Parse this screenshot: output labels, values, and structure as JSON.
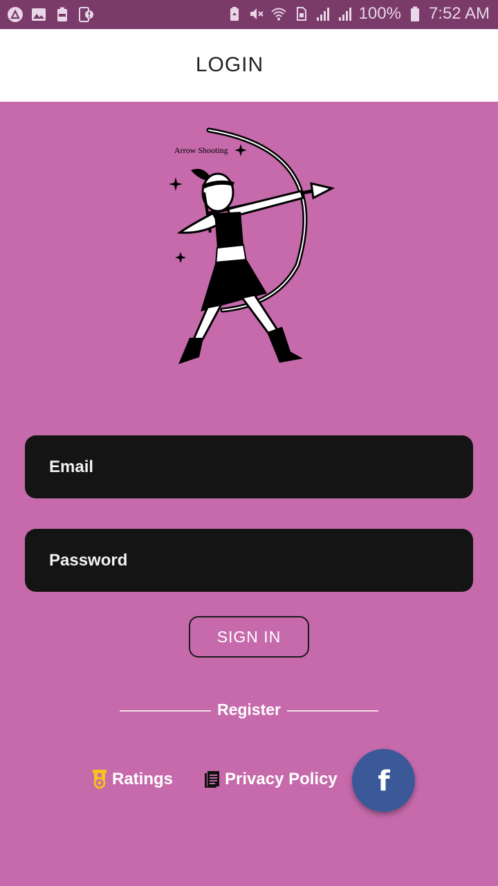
{
  "status_bar": {
    "battery_percent": "100%",
    "time": "7:52 AM"
  },
  "app_bar": {
    "title": "LOGIN"
  },
  "logo": {
    "caption": "Arrow Shooting"
  },
  "form": {
    "email_placeholder": "Email",
    "password_placeholder": "Password",
    "signin_label": "SIGN IN"
  },
  "register": {
    "label": "Register"
  },
  "footer": {
    "ratings_label": "Ratings",
    "privacy_label": "Privacy Policy",
    "facebook_glyph": "f"
  },
  "colors": {
    "background": "#c66aab",
    "status_bar": "#7a3a6a",
    "field_bg": "#141414",
    "facebook_blue": "#3b5998",
    "medal_gold": "#f6c21b"
  }
}
